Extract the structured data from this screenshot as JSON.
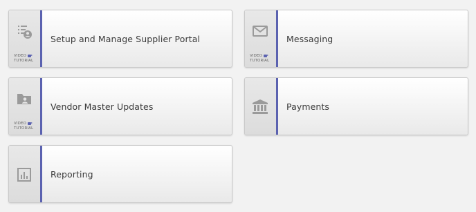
{
  "tiles": [
    {
      "label": "Setup and Manage Supplier Portal",
      "icon": "user-list-icon",
      "video_line1": "VIDEO",
      "video_line2": "TUTORIAL"
    },
    {
      "label": "Messaging",
      "icon": "envelope-icon",
      "video_line1": "VIDEO",
      "video_line2": "TUTORIAL"
    },
    {
      "label": "Vendor Master Updates",
      "icon": "folder-user-icon",
      "video_line1": "VIDEO",
      "video_line2": "TUTORIAL"
    },
    {
      "label": "Payments",
      "icon": "bank-icon"
    },
    {
      "label": "Reporting",
      "icon": "bar-chart-icon"
    }
  ],
  "colors": {
    "accent": "#5b62b0",
    "icon": "#9a9a9a",
    "text": "#3a3a3a"
  }
}
